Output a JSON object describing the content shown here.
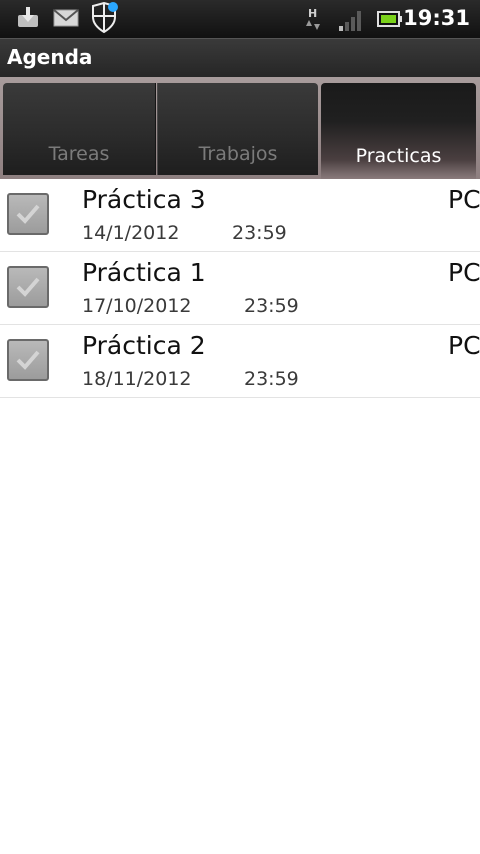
{
  "status_bar": {
    "time": "19:31",
    "icons": [
      "download-icon",
      "gmail-icon",
      "security-shield-icon",
      "hspa-data-icon",
      "signal-icon",
      "battery-icon"
    ]
  },
  "header": {
    "title": "Agenda"
  },
  "tabs": [
    {
      "label": "Tareas",
      "selected": false
    },
    {
      "label": "Trabajos",
      "selected": false
    },
    {
      "label": "Practicas",
      "selected": true
    }
  ],
  "items": [
    {
      "title": "Práctica 3",
      "date": "14/1/2012",
      "time": "23:59",
      "tag": "PC",
      "checked": true
    },
    {
      "title": "Práctica 1",
      "date": "17/10/2012",
      "time": "23:59",
      "tag": "PC",
      "checked": true
    },
    {
      "title": "Práctica 2",
      "date": "18/11/2012",
      "time": "23:59",
      "tag": "PC",
      "checked": true
    }
  ],
  "colors": {
    "tab_accent": "#a89c9c",
    "checkbox": "#a9a9a9",
    "notification_dot": "#2aa7ff"
  }
}
